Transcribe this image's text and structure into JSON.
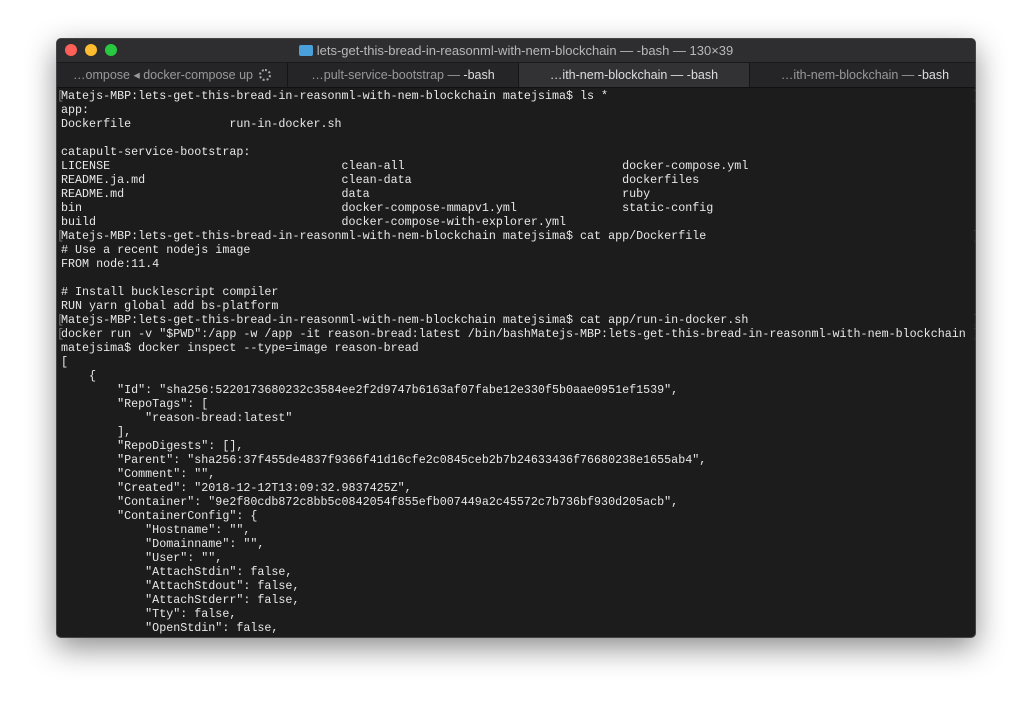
{
  "window": {
    "title": "lets-get-this-bread-in-reasonml-with-nem-blockchain — -bash — 130×39"
  },
  "tabs": [
    {
      "label": "…ompose ◂ docker-compose up",
      "suffix": ""
    },
    {
      "label": "…pult-service-bootstrap — ",
      "suffix": "-bash"
    },
    {
      "label": "…ith-nem-blockchain — ",
      "suffix": "-bash"
    },
    {
      "label": "…ith-nem-blockchain — ",
      "suffix": "-bash"
    }
  ],
  "new_tab": "+",
  "terminal": {
    "lines": [
      {
        "text": "Matejs-MBP:lets-get-this-bread-in-reasonml-with-nem-blockchain matejsima$ ls *",
        "mark": true
      },
      {
        "text": "app:"
      },
      {
        "text": "Dockerfile              run-in-docker.sh"
      },
      {
        "text": ""
      },
      {
        "text": "catapult-service-bootstrap:"
      },
      {
        "text": "LICENSE                                 clean-all                               docker-compose.yml"
      },
      {
        "text": "README.ja.md                            clean-data                              dockerfiles"
      },
      {
        "text": "README.md                               data                                    ruby"
      },
      {
        "text": "bin                                     docker-compose-mmapv1.yml               static-config"
      },
      {
        "text": "build                                   docker-compose-with-explorer.yml"
      },
      {
        "text": "Matejs-MBP:lets-get-this-bread-in-reasonml-with-nem-blockchain matejsima$ cat app/Dockerfile",
        "mark": true
      },
      {
        "text": "# Use a recent nodejs image"
      },
      {
        "text": "FROM node:11.4"
      },
      {
        "text": ""
      },
      {
        "text": "# Install bucklescript compiler"
      },
      {
        "text": "RUN yarn global add bs-platform"
      },
      {
        "text": "Matejs-MBP:lets-get-this-bread-in-reasonml-with-nem-blockchain matejsima$ cat app/run-in-docker.sh",
        "mark": true
      },
      {
        "text": "docker run -v \"$PWD\":/app -w /app -it reason-bread:latest /bin/bashMatejs-MBP:lets-get-this-bread-in-reasonml-with-nem-blockchain",
        "mark": true
      },
      {
        "text": "matejsima$ docker inspect --type=image reason-bread"
      },
      {
        "text": "["
      },
      {
        "text": "    {"
      },
      {
        "text": "        \"Id\": \"sha256:5220173680232c3584ee2f2d9747b6163af07fabe12e330f5b0aae0951ef1539\","
      },
      {
        "text": "        \"RepoTags\": ["
      },
      {
        "text": "            \"reason-bread:latest\""
      },
      {
        "text": "        ],"
      },
      {
        "text": "        \"RepoDigests\": [],"
      },
      {
        "text": "        \"Parent\": \"sha256:37f455de4837f9366f41d16cfe2c0845ceb2b7b24633436f76680238e1655ab4\","
      },
      {
        "text": "        \"Comment\": \"\","
      },
      {
        "text": "        \"Created\": \"2018-12-12T13:09:32.9837425Z\","
      },
      {
        "text": "        \"Container\": \"9e2f80cdb872c8bb5c0842054f855efb007449a2c45572c7b736bf930d205acb\","
      },
      {
        "text": "        \"ContainerConfig\": {"
      },
      {
        "text": "            \"Hostname\": \"\","
      },
      {
        "text": "            \"Domainname\": \"\","
      },
      {
        "text": "            \"User\": \"\","
      },
      {
        "text": "            \"AttachStdin\": false,"
      },
      {
        "text": "            \"AttachStdout\": false,"
      },
      {
        "text": "            \"AttachStderr\": false,"
      },
      {
        "text": "            \"Tty\": false,"
      },
      {
        "text": "            \"OpenStdin\": false,"
      }
    ]
  }
}
